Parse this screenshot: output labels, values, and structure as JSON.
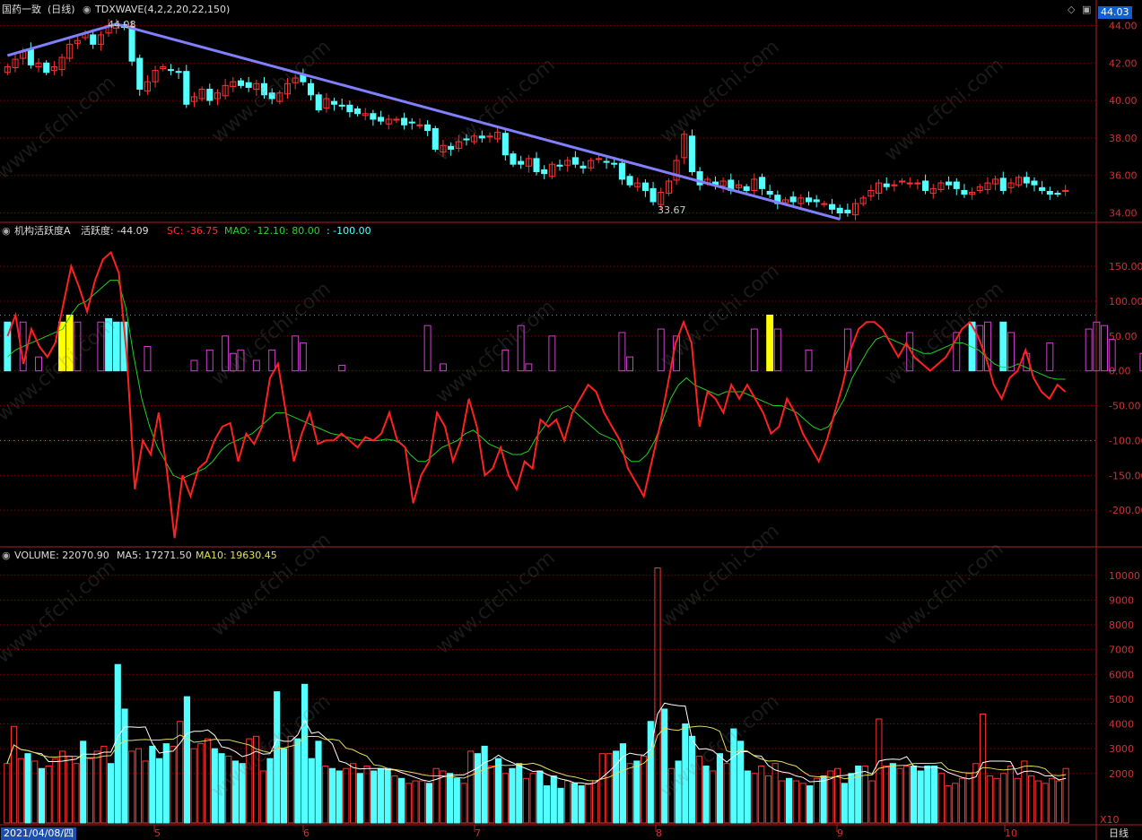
{
  "header": {
    "stock_name": "国药一致",
    "period": "(日线)",
    "indicator": "TDXWAVE(4,2,2,20,22,150)",
    "price_high_label": "44.08",
    "price_low_label": "33.67",
    "last_price_badge": "44.03"
  },
  "panel2": {
    "name": "机构活跃度A",
    "value_label": "活跃度: -44.09",
    "sc_label": "SC: -36.75",
    "mao_label": "MAO: -12.10",
    "l80_label": ": 80.00",
    "l100_label": ": -100.00"
  },
  "panel3": {
    "vol_label": "VOLUME: 22070.90",
    "ma5_label": "MA5: 17271.50",
    "ma10_label": "MA10: 19630.45",
    "multiplier": "X10"
  },
  "xaxis": {
    "start_date": "2021/04/08/四",
    "months": [
      "5",
      "6",
      "7",
      "8",
      "9",
      "10"
    ],
    "period_label": "日线"
  },
  "colors": {
    "up": "#ff3232",
    "down": "#54ffff",
    "grid": "#8b0000",
    "wave": "#8080ff",
    "sc": "#ff2020",
    "mao": "#20d020",
    "ma10": "#e0e060",
    "purple": "#d040d0",
    "yellow": "#ffff00"
  },
  "watermark": "www.cfchi.com",
  "chart_data": [
    {
      "type": "candlestick",
      "title": "TDXWAVE(4,2,2,20,22,150)",
      "ylim": [
        33.5,
        44.5
      ],
      "yticks": [
        34.0,
        36.0,
        38.0,
        40.0,
        42.0,
        44.0
      ],
      "closes": [
        41.8,
        42.2,
        42.6,
        41.9,
        42.0,
        41.5,
        41.8,
        42.3,
        43.0,
        43.2,
        43.6,
        43.0,
        43.5,
        44.0,
        44.1,
        43.9,
        42.1,
        40.6,
        41.0,
        41.6,
        41.8,
        41.6,
        41.5,
        39.8,
        40.2,
        40.6,
        40.0,
        40.4,
        40.8,
        41.0,
        40.8,
        40.7,
        40.9,
        40.3,
        40.1,
        40.4,
        40.9,
        41.2,
        41.0,
        40.3,
        39.5,
        40.1,
        39.8,
        39.7,
        39.4,
        39.3,
        39.3,
        39.0,
        38.9,
        39.0,
        39.0,
        38.7,
        38.8,
        38.7,
        38.4,
        37.4,
        37.6,
        37.4,
        37.8,
        37.9,
        38.1,
        38.0,
        38.1,
        38.3,
        37.1,
        36.6,
        36.6,
        36.9,
        36.2,
        36.1,
        36.6,
        36.5,
        36.8,
        36.6,
        36.4,
        36.8,
        36.9,
        36.7,
        36.6,
        35.8,
        35.5,
        35.6,
        35.2,
        34.6,
        35.1,
        35.7,
        36.8,
        38.2,
        36.2,
        35.5,
        35.8,
        35.5,
        35.7,
        35.2,
        35.5,
        35.2,
        35.8,
        35.3,
        35.0,
        34.5,
        34.7,
        34.6,
        34.8,
        34.6,
        34.6,
        34.5,
        34.2,
        34.0,
        34.0,
        34.5,
        34.8,
        35.2,
        35.6,
        35.4,
        35.5,
        35.7,
        35.6,
        35.6,
        35.2,
        35.3,
        35.6,
        35.5,
        35.3,
        35.0,
        35.1,
        35.4,
        35.6,
        35.8,
        35.2,
        35.6,
        35.9,
        35.6,
        35.5,
        35.2,
        35.0,
        35.0,
        35.2
      ]
    },
    {
      "type": "line",
      "title": "机构活跃度A",
      "ylim": [
        -250,
        190
      ],
      "yticks": [
        150,
        100,
        50,
        0,
        -50,
        -100,
        -150,
        -200
      ],
      "reference_lines": [
        80,
        -100
      ],
      "series": [
        {
          "name": "SC",
          "values": [
            50,
            80,
            10,
            60,
            35,
            20,
            40,
            95,
            150,
            120,
            85,
            130,
            160,
            170,
            140,
            20,
            -170,
            -100,
            -120,
            -60,
            -140,
            -240,
            -150,
            -180,
            -140,
            -130,
            -100,
            -80,
            -75,
            -130,
            -90,
            -105,
            -80,
            -10,
            10,
            -60,
            -130,
            -90,
            -60,
            -105,
            -100,
            -100,
            -90,
            -100,
            -110,
            -95,
            -100,
            -90,
            -60,
            -100,
            -110,
            -190,
            -150,
            -130,
            -60,
            -80,
            -130,
            -100,
            -40,
            -80,
            -150,
            -140,
            -110,
            -150,
            -170,
            -130,
            -140,
            -70,
            -80,
            -70,
            -100,
            -60,
            -40,
            -20,
            -30,
            -60,
            -80,
            -100,
            -140,
            -160,
            -180,
            -130,
            -80,
            -20,
            40,
            70,
            40,
            -80,
            -30,
            -40,
            -60,
            -20,
            -40,
            -20,
            -40,
            -60,
            -90,
            -80,
            -40,
            -60,
            -90,
            -110,
            -130,
            -100,
            -60,
            -20,
            30,
            60,
            70,
            70,
            60,
            40,
            20,
            40,
            20,
            10,
            0,
            10,
            20,
            40,
            60,
            70,
            50,
            20,
            -20,
            -40,
            -10,
            0,
            30,
            -10,
            -30,
            -40,
            -20,
            -30
          ]
        },
        {
          "name": "MAO",
          "values": [
            20,
            30,
            35,
            40,
            45,
            50,
            55,
            60,
            80,
            95,
            100,
            110,
            120,
            130,
            130,
            90,
            20,
            -40,
            -80,
            -110,
            -130,
            -150,
            -155,
            -150,
            -145,
            -140,
            -130,
            -115,
            -105,
            -100,
            -95,
            -90,
            -80,
            -70,
            -60,
            -60,
            -65,
            -70,
            -75,
            -80,
            -85,
            -90,
            -92,
            -95,
            -98,
            -100,
            -100,
            -100,
            -98,
            -100,
            -105,
            -120,
            -130,
            -130,
            -120,
            -110,
            -105,
            -100,
            -90,
            -85,
            -95,
            -105,
            -110,
            -115,
            -120,
            -120,
            -115,
            -95,
            -80,
            -60,
            -55,
            -50,
            -60,
            -70,
            -80,
            -90,
            -95,
            -100,
            -120,
            -130,
            -130,
            -120,
            -100,
            -70,
            -40,
            -20,
            -10,
            -20,
            -25,
            -30,
            -35,
            -30,
            -30,
            -30,
            -35,
            -40,
            -45,
            -50,
            -50,
            -55,
            -60,
            -70,
            -80,
            -85,
            -80,
            -60,
            -40,
            -10,
            10,
            30,
            45,
            50,
            45,
            40,
            35,
            30,
            25,
            25,
            30,
            35,
            40,
            40,
            35,
            30,
            20,
            10,
            5,
            5,
            10,
            5,
            0,
            -5,
            -10,
            -12,
            -12
          ]
        },
        {
          "name": "活跃度",
          "bars": [
            {
              "i": 0,
              "v": 70,
              "c": "cyan"
            },
            {
              "i": 2,
              "v": 70,
              "c": "purple"
            },
            {
              "i": 4,
              "v": 20,
              "c": "purple"
            },
            {
              "i": 7,
              "v": 70,
              "c": "yellow"
            },
            {
              "i": 8,
              "v": 80,
              "c": "yellow"
            },
            {
              "i": 9,
              "v": 70,
              "c": "purple"
            },
            {
              "i": 12,
              "v": 70,
              "c": "purple"
            },
            {
              "i": 13,
              "v": 75,
              "c": "cyan"
            },
            {
              "i": 14,
              "v": 70,
              "c": "cyan"
            },
            {
              "i": 15,
              "v": 70,
              "c": "cyan"
            },
            {
              "i": 18,
              "v": 35,
              "c": "purple"
            },
            {
              "i": 24,
              "v": 15,
              "c": "purple"
            },
            {
              "i": 26,
              "v": 30,
              "c": "purple"
            },
            {
              "i": 28,
              "v": 50,
              "c": "purple"
            },
            {
              "i": 29,
              "v": 25,
              "c": "purple"
            },
            {
              "i": 30,
              "v": 30,
              "c": "purple"
            },
            {
              "i": 32,
              "v": 15,
              "c": "purple"
            },
            {
              "i": 34,
              "v": 30,
              "c": "purple"
            },
            {
              "i": 37,
              "v": 50,
              "c": "purple"
            },
            {
              "i": 38,
              "v": 40,
              "c": "purple"
            },
            {
              "i": 43,
              "v": 8,
              "c": "purple"
            },
            {
              "i": 54,
              "v": 65,
              "c": "purple"
            },
            {
              "i": 56,
              "v": 10,
              "c": "purple"
            },
            {
              "i": 64,
              "v": 30,
              "c": "purple"
            },
            {
              "i": 66,
              "v": 65,
              "c": "purple"
            },
            {
              "i": 67,
              "v": 10,
              "c": "purple"
            },
            {
              "i": 70,
              "v": 50,
              "c": "purple"
            },
            {
              "i": 79,
              "v": 55,
              "c": "purple"
            },
            {
              "i": 80,
              "v": 20,
              "c": "purple"
            },
            {
              "i": 84,
              "v": 60,
              "c": "purple"
            },
            {
              "i": 86,
              "v": 50,
              "c": "purple"
            },
            {
              "i": 96,
              "v": 60,
              "c": "purple"
            },
            {
              "i": 98,
              "v": 80,
              "c": "yellow"
            },
            {
              "i": 99,
              "v": 60,
              "c": "purple"
            },
            {
              "i": 103,
              "v": 30,
              "c": "purple"
            },
            {
              "i": 108,
              "v": 60,
              "c": "purple"
            },
            {
              "i": 116,
              "v": 55,
              "c": "purple"
            },
            {
              "i": 122,
              "v": 55,
              "c": "purple"
            },
            {
              "i": 124,
              "v": 70,
              "c": "cyan"
            },
            {
              "i": 125,
              "v": 65,
              "c": "purple"
            },
            {
              "i": 126,
              "v": 70,
              "c": "purple"
            },
            {
              "i": 128,
              "v": 70,
              "c": "cyan"
            },
            {
              "i": 129,
              "v": 55,
              "c": "purple"
            },
            {
              "i": 131,
              "v": 25,
              "c": "purple"
            },
            {
              "i": 134,
              "v": 40,
              "c": "purple"
            },
            {
              "i": 139,
              "v": 60,
              "c": "purple"
            },
            {
              "i": 140,
              "v": 70,
              "c": "purple"
            },
            {
              "i": 141,
              "v": 65,
              "c": "purple"
            },
            {
              "i": 142,
              "v": 45,
              "c": "purple"
            },
            {
              "i": 146,
              "v": 25,
              "c": "purple"
            },
            {
              "i": 147,
              "v": 15,
              "c": "purple"
            },
            {
              "i": 148,
              "v": 55,
              "c": "purple"
            },
            {
              "i": 149,
              "v": 15,
              "c": "purple"
            },
            {
              "i": 150,
              "v": 65,
              "c": "purple"
            },
            {
              "i": 153,
              "v": 5,
              "c": "purple"
            }
          ]
        }
      ]
    },
    {
      "type": "bar",
      "title": "VOLUME",
      "ylim": [
        0,
        10500
      ],
      "yticks": [
        2000,
        3000,
        4000,
        5000,
        6000,
        7000,
        8000,
        9000,
        10000
      ],
      "values": [
        2400,
        3900,
        2600,
        2800,
        2500,
        2200,
        2300,
        2600,
        2900,
        2700,
        2400,
        3300,
        2600,
        2900,
        3100,
        2400,
        6400,
        4600,
        2900,
        3000,
        2500,
        3100,
        2600,
        3200,
        3100,
        4100,
        5100,
        3000,
        3200,
        3400,
        3000,
        2800,
        2700,
        2500,
        2400,
        3400,
        3500,
        2100,
        2600,
        5300,
        3000,
        3500,
        3400,
        5600,
        2600,
        3300,
        2300,
        2200,
        2100,
        2200,
        2400,
        2000,
        2300,
        2100,
        2200,
        2200,
        1900,
        1800,
        1600,
        1700,
        1700,
        1600,
        2200,
        2100,
        2000,
        1800,
        1600,
        2900,
        2800,
        3100,
        2300,
        2600,
        2000,
        2200,
        2400,
        1800,
        2000,
        2100,
        1500,
        1900,
        1400,
        1700,
        1600,
        1500,
        1600,
        1700,
        2800,
        2800,
        2900,
        3200,
        2400,
        2500,
        2700,
        4100,
        10300,
        4600,
        2200,
        2500,
        4000,
        3500,
        2700,
        2300,
        2100,
        2800,
        2400,
        3800,
        3300,
        2100,
        2000,
        2300,
        1900,
        2400,
        1700,
        1800,
        1700,
        1600,
        1500,
        1800,
        1900,
        2100,
        2200,
        1600,
        2000,
        2300,
        2300,
        1700,
        4200,
        2300,
        2400,
        2200,
        2300,
        2300,
        2100,
        2300,
        2300,
        2000,
        1500,
        1600,
        1800,
        2000,
        2400,
        4400,
        1900,
        1800,
        2000,
        2300,
        1800,
        2500,
        1900,
        1700,
        1600,
        1800,
        1700,
        2200
      ]
    }
  ]
}
